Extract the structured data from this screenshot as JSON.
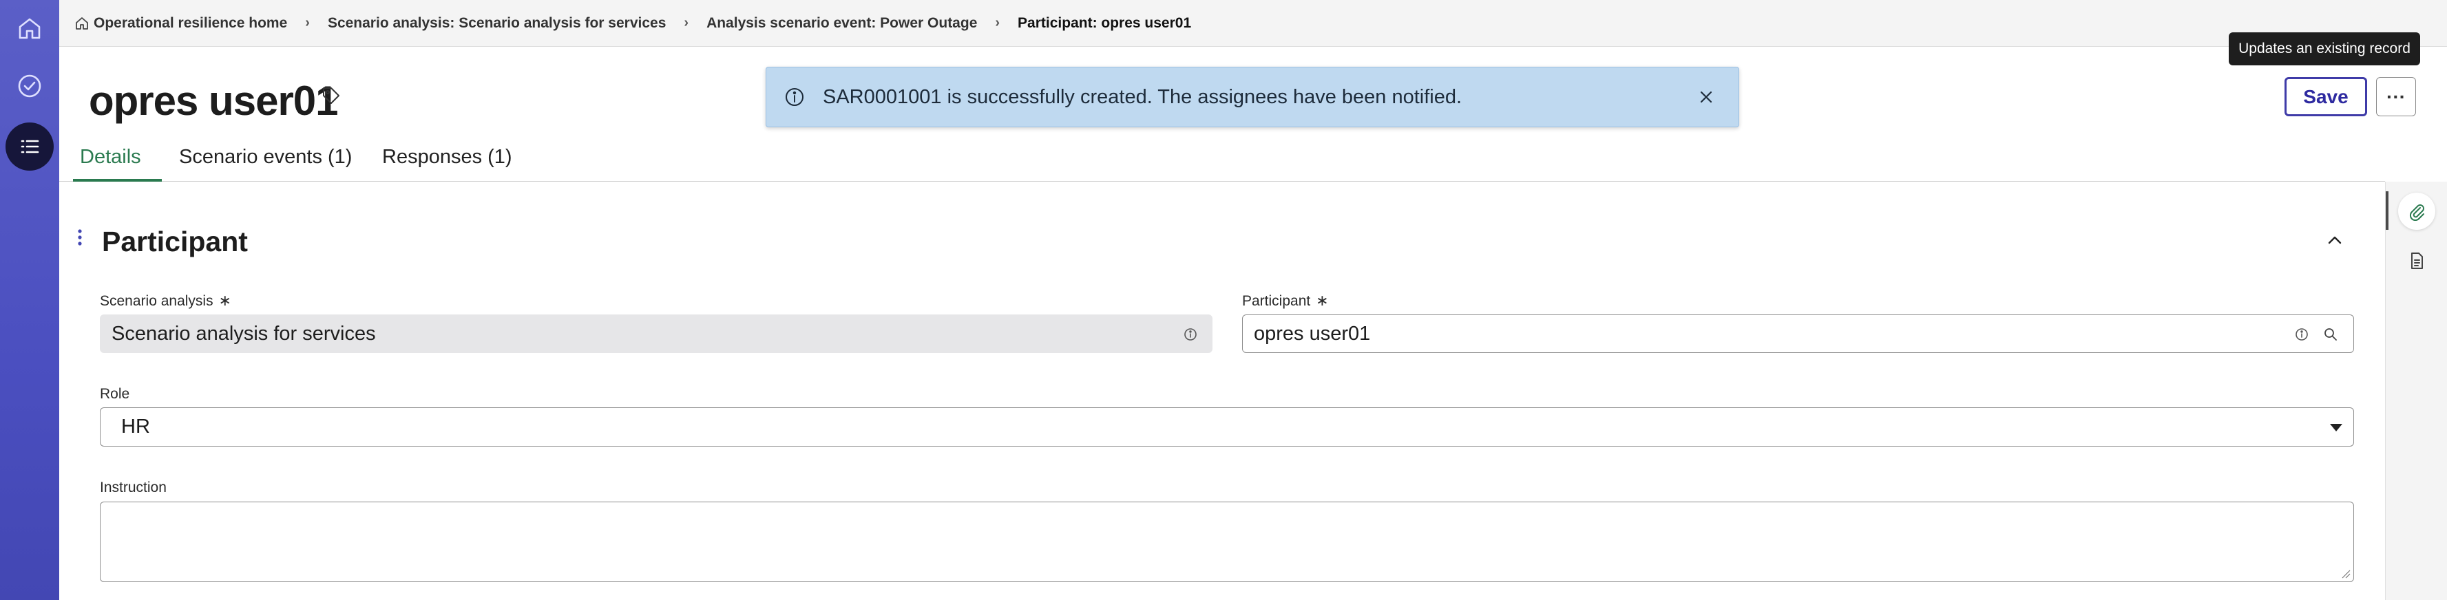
{
  "breadcrumbs": [
    {
      "label": "Operational resilience home"
    },
    {
      "label": "Scenario analysis: Scenario analysis for services"
    },
    {
      "label": "Analysis scenario event: Power Outage"
    },
    {
      "label": "Participant: opres user01"
    }
  ],
  "header": {
    "title": "opres user01",
    "save_label": "Save",
    "more_label": "···",
    "save_tooltip": "Updates an existing record"
  },
  "toast": {
    "message": "SAR0001001 is successfully created. The assignees have been notified."
  },
  "tabs": [
    {
      "label": "Details",
      "active": true
    },
    {
      "label": "Scenario events (1)",
      "active": false
    },
    {
      "label": "Responses (1)",
      "active": false
    }
  ],
  "section": {
    "title": "Participant"
  },
  "form": {
    "scenario_analysis": {
      "label": "Scenario analysis",
      "required_mark": "∗",
      "value": "Scenario analysis for services"
    },
    "participant": {
      "label": "Participant",
      "required_mark": "∗",
      "value": "opres user01"
    },
    "role": {
      "label": "Role",
      "value": "HR"
    },
    "instruction": {
      "label": "Instruction",
      "value": ""
    }
  },
  "colors": {
    "rail": "#4b4fc0",
    "accent_tab": "#2a7a4f",
    "toast_bg": "#bfd9f0",
    "save_border": "#3f3ba8"
  },
  "icons": {
    "rail": [
      "home-icon",
      "check-circle-icon",
      "list-icon"
    ],
    "utility": [
      "paperclip-icon",
      "document-icon"
    ]
  }
}
